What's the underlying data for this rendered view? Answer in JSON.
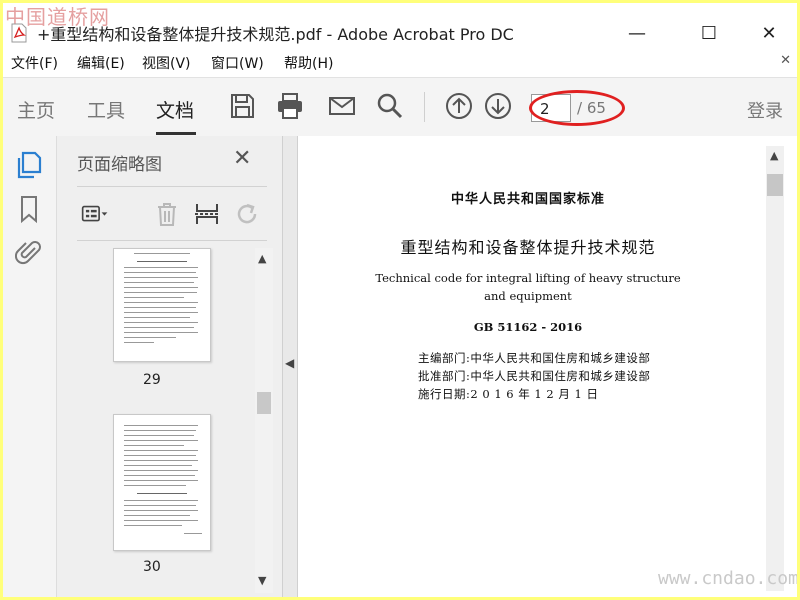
{
  "watermark_top": "中国道桥网",
  "watermark_bottom": "www.cndao.com",
  "window": {
    "title": "+重型结构和设备整体提升技术规范.pdf - Adobe Acrobat Pro DC",
    "buttons": {
      "minimize": "—",
      "maximize": "☐",
      "close": "✕"
    }
  },
  "menu": {
    "items": [
      "文件(F)",
      "编辑(E)",
      "视图(V)",
      "窗口(W)",
      "帮助(H)"
    ],
    "close": "✕"
  },
  "toolbar": {
    "tabs": [
      "主页",
      "工具",
      "文档"
    ],
    "active_tab": "文档",
    "icons": [
      "save-icon",
      "print-icon",
      "mail-icon",
      "search-icon",
      "page-up-icon",
      "page-down-icon"
    ],
    "page_current": "2",
    "page_total": "/ 65",
    "login": "登录",
    "highlight_color": "#e02020"
  },
  "left_rail": {
    "icons": [
      "page-thumbnails-icon",
      "bookmark-icon",
      "attachment-icon"
    ],
    "active_color": "#2b7fd0"
  },
  "thumbnails_panel": {
    "title": "页面缩略图",
    "close": "✕",
    "tools": [
      "options-icon",
      "delete-icon",
      "insert-icon",
      "rotate-icon"
    ],
    "pages": [
      {
        "number": "29"
      },
      {
        "number": "30"
      }
    ]
  },
  "document": {
    "standard_header": "中华人民共和国国家标准",
    "title_cn": "重型结构和设备整体提升技术规范",
    "title_en_line1": "Technical code for integral lifting of heavy structure",
    "title_en_line2": "and equipment",
    "code": "GB 51162 - 2016",
    "chief_dept": "主编部门:中华人民共和国住房和城乡建设部",
    "approval_dept": "批准部门:中华人民共和国住房和城乡建设部",
    "effective_date": "施行日期:2 0 1 6 年 1 2 月 1 日"
  }
}
